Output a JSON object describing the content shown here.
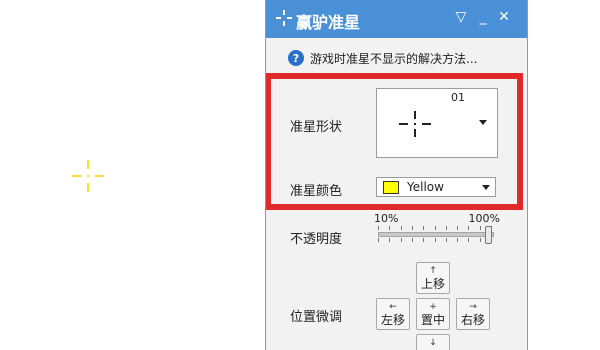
{
  "window": {
    "title": "赢驴准星"
  },
  "help": {
    "text": "游戏时准星不显示的解决方法..."
  },
  "crosshair_shape": {
    "label": "准星形状",
    "number": "01"
  },
  "crosshair_color": {
    "label": "准星颜色",
    "selected": "Yellow",
    "swatch_color": "#ffff00"
  },
  "opacity": {
    "label": "不透明度",
    "min_label": "10%",
    "max_label": "100%",
    "value_percent": 100
  },
  "position": {
    "label": "位置微调",
    "up": {
      "arrow": "↑",
      "label": "上移"
    },
    "left": {
      "arrow": "←",
      "label": "左移"
    },
    "center": {
      "arrow": "+",
      "label": "置中"
    },
    "right": {
      "arrow": "→",
      "label": "右移"
    },
    "down": {
      "arrow": "↓",
      "label": ""
    }
  },
  "colors": {
    "titlebar": "#4a90d6",
    "highlight_frame": "#e02a2a",
    "desktop_crosshair": "#f3e13a"
  },
  "icons": [
    "crosshair-logo-icon",
    "help-icon",
    "dropdown-arrow-icon",
    "minimize-icon",
    "close-icon",
    "collapse-icon"
  ]
}
